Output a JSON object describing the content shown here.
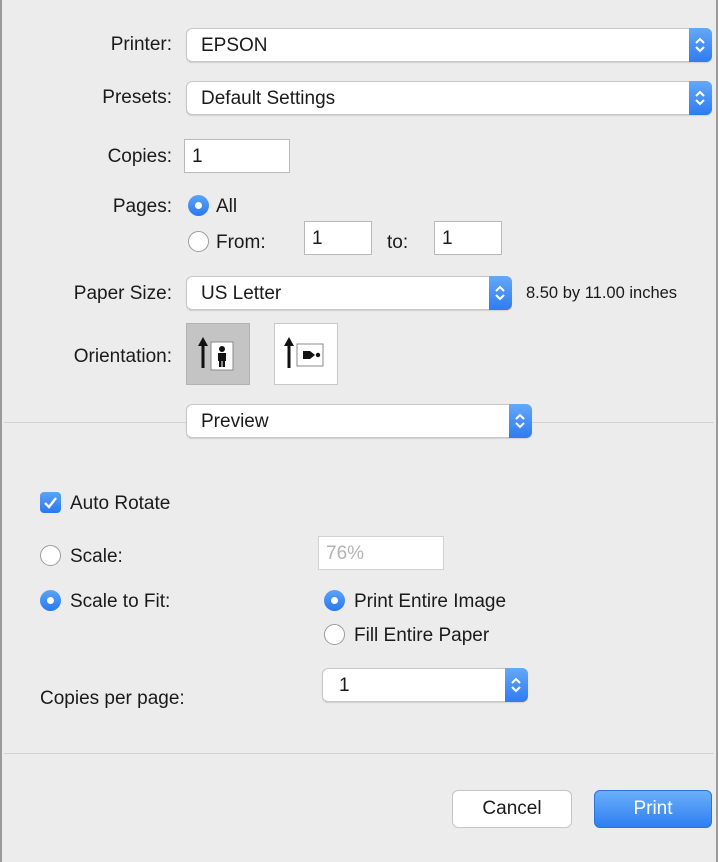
{
  "printer": {
    "label": "Printer:",
    "value": "EPSON"
  },
  "presets": {
    "label": "Presets:",
    "value": "Default Settings"
  },
  "copies": {
    "label": "Copies:",
    "value": "1"
  },
  "pages": {
    "label": "Pages:",
    "all_label": "All",
    "from_label": "From:",
    "from_value": "1",
    "to_label": "to:",
    "to_value": "1",
    "selected": "All"
  },
  "paper_size": {
    "label": "Paper Size:",
    "value": "US Letter",
    "dimensions": "8.50 by 11.00 inches"
  },
  "orientation": {
    "label": "Orientation:",
    "options": [
      "portrait",
      "landscape"
    ],
    "selected": "portrait"
  },
  "section_menu": {
    "value": "Preview"
  },
  "auto_rotate": {
    "label": "Auto Rotate",
    "checked": true
  },
  "scale": {
    "label": "Scale:",
    "value": "76%",
    "selected": false
  },
  "scale_to_fit": {
    "label": "Scale to Fit:",
    "selected": true,
    "options": {
      "print_entire_image": "Print Entire Image",
      "fill_entire_paper": "Fill Entire Paper"
    },
    "selected_option": "Print Entire Image"
  },
  "copies_per_page": {
    "label": "Copies per page:",
    "value": "1"
  },
  "buttons": {
    "cancel": "Cancel",
    "print": "Print"
  },
  "colors": {
    "accent": "#2d7cf0",
    "background": "#ececec"
  }
}
